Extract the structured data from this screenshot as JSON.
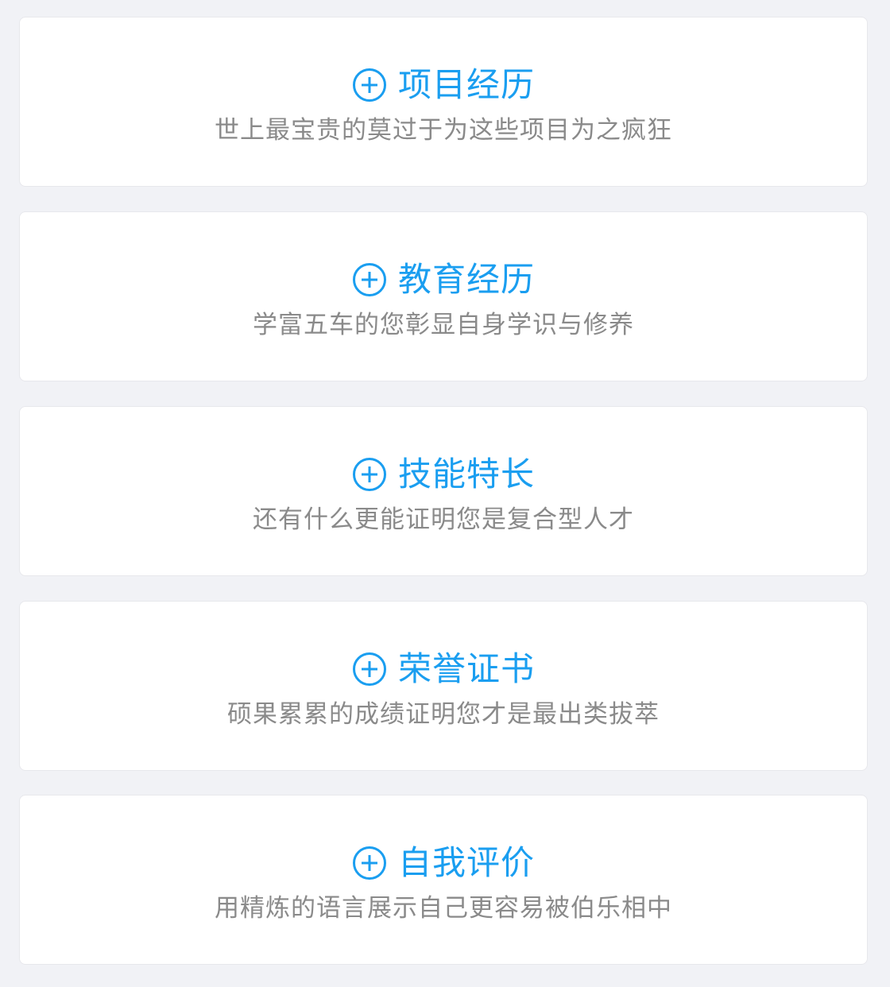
{
  "accent_color": "#1a9ef0",
  "cards": [
    {
      "icon": "plus-circle-icon",
      "title": "项目经历",
      "subtitle": "世上最宝贵的莫过于为这些项目为之疯狂"
    },
    {
      "icon": "plus-circle-icon",
      "title": "教育经历",
      "subtitle": "学富五车的您彰显自身学识与修养"
    },
    {
      "icon": "plus-circle-icon",
      "title": "技能特长",
      "subtitle": "还有什么更能证明您是复合型人才"
    },
    {
      "icon": "plus-circle-icon",
      "title": "荣誉证书",
      "subtitle": "硕果累累的成绩证明您才是最出类拔萃"
    },
    {
      "icon": "plus-circle-icon",
      "title": "自我评价",
      "subtitle": "用精炼的语言展示自己更容易被伯乐相中"
    }
  ]
}
